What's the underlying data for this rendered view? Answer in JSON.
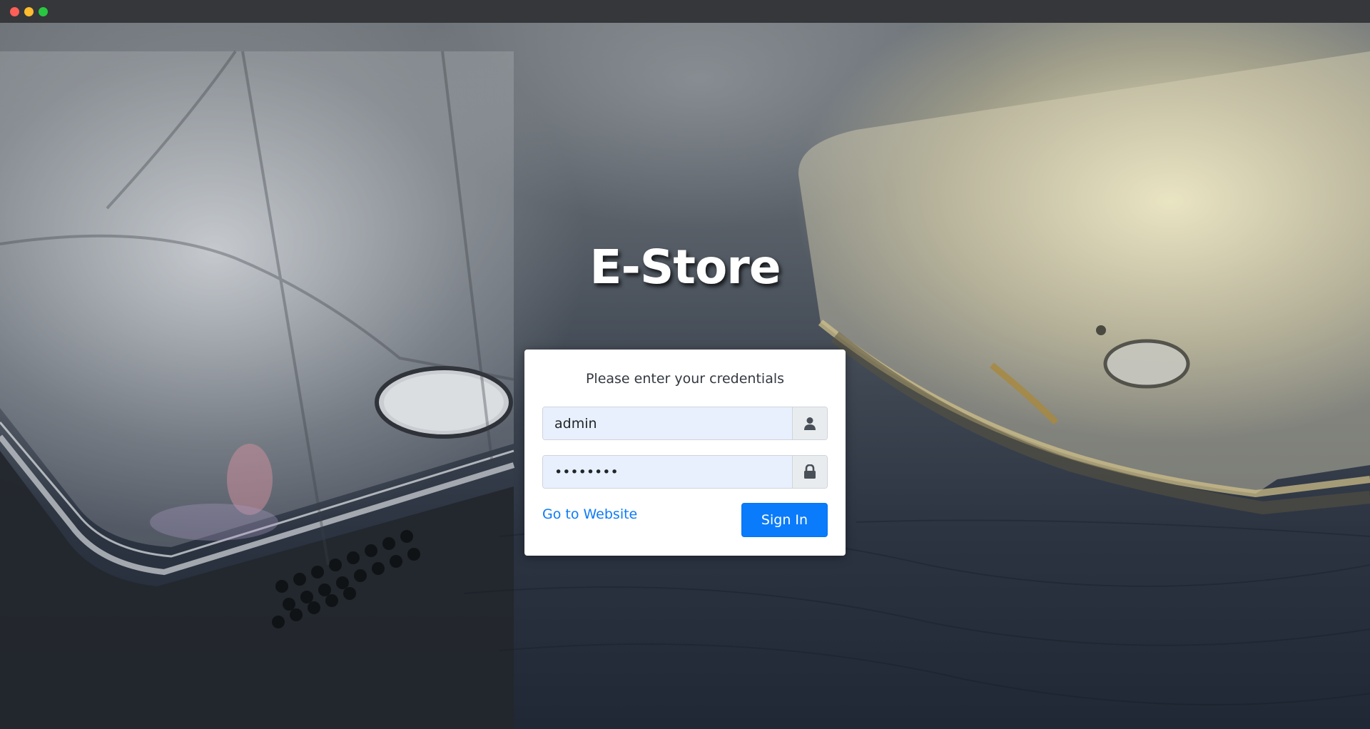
{
  "app": {
    "brand_title": "E-Store"
  },
  "login": {
    "prompt": "Please enter your credentials",
    "username_value": "admin",
    "password_value": "********",
    "go_to_website_label": "Go to Website",
    "sign_in_label": "Sign In"
  },
  "icons": {
    "username_addon": "user-icon",
    "password_addon": "lock-icon"
  },
  "colors": {
    "primary": "#0a7bfb",
    "link": "#0d7bf7",
    "input_autofill_bg": "#e8f0fe"
  }
}
